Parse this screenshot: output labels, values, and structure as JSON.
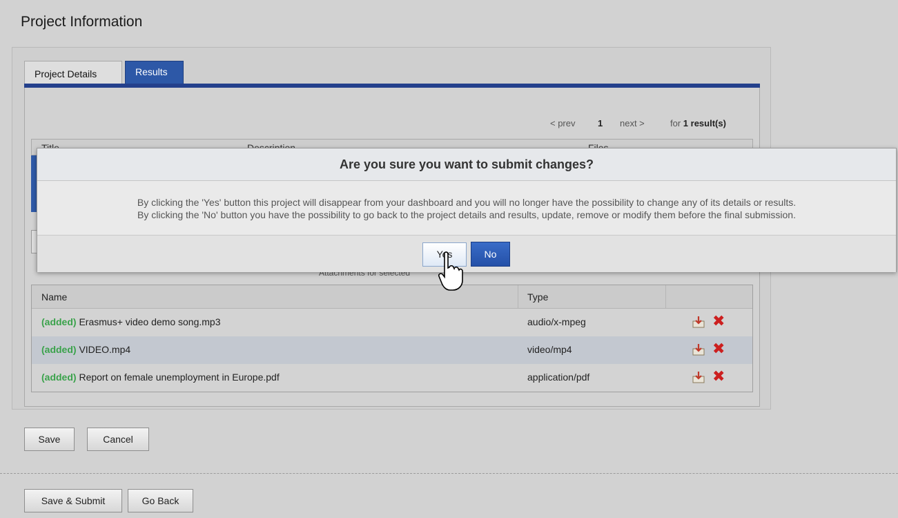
{
  "page_title": "Project Information",
  "tabs": [
    {
      "label": "Project Details",
      "active": false
    },
    {
      "label": "Results",
      "active": true
    }
  ],
  "pager": {
    "prev": "< prev",
    "page": "1",
    "next": "next >",
    "for_text": "for",
    "count": "1 result(s)"
  },
  "results_table": {
    "columns": [
      "Title",
      "Description",
      "Files"
    ]
  },
  "attachments_label": "Attachments for selected",
  "files_table": {
    "columns": [
      "Name",
      "Type"
    ],
    "rows": [
      {
        "status": "(added)",
        "name": "Erasmus+ video demo song.mp3",
        "type": "audio/x-mpeg"
      },
      {
        "status": "(added)",
        "name": "VIDEO.mp4",
        "type": "video/mp4"
      },
      {
        "status": "(added)",
        "name": "Report on female unemployment in Europe.pdf",
        "type": "application/pdf"
      }
    ],
    "row_actions": {
      "download_icon": "download-icon",
      "delete_icon": "delete-icon",
      "delete_glyph": "✖"
    }
  },
  "buttons": {
    "save": "Save",
    "cancel": "Cancel",
    "save_submit": "Save & Submit",
    "go_back": "Go Back"
  },
  "modal": {
    "title": "Are you sure you want to submit changes?",
    "body_line1": "By clicking the 'Yes' button this project will disappear from your dashboard and you will no longer have the possibility to change any of its details or results.",
    "body_line2": "By clicking the 'No' button you have the possibility to go back to the project details and results, update, remove or modify them before the final submission.",
    "yes_label": "Yes",
    "no_label": "No"
  },
  "colors": {
    "tab_active": "#2d58a7",
    "tab_bar": "#24408c",
    "added_status": "#3aa24b",
    "delete_icon": "#cc1f1f",
    "no_button": "#2450a8"
  }
}
